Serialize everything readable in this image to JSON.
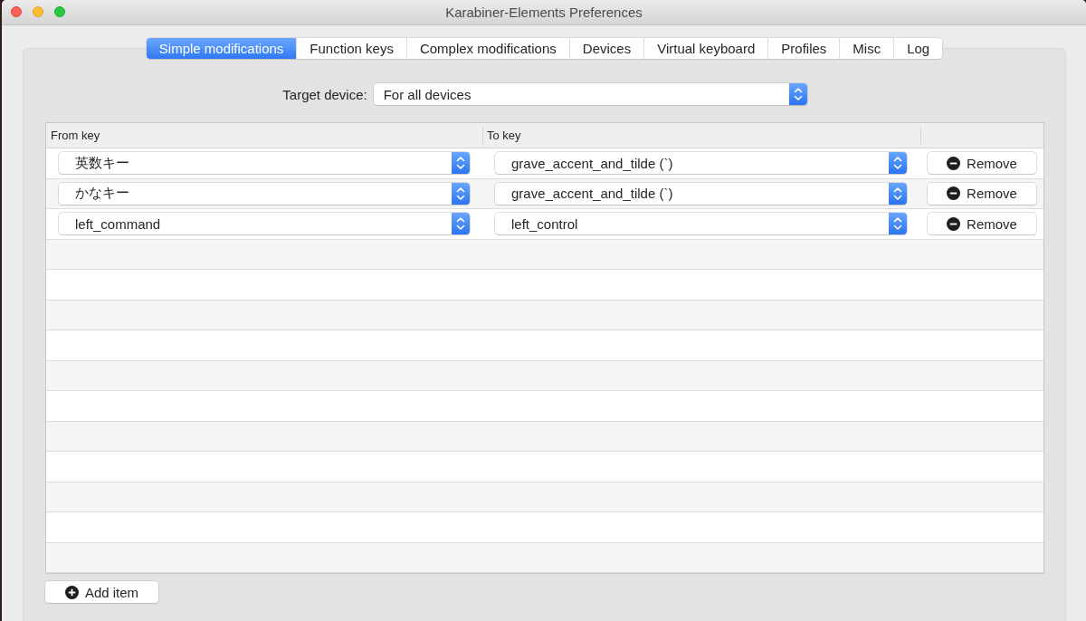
{
  "window": {
    "title": "Karabiner-Elements Preferences"
  },
  "tabs": [
    {
      "label": "Simple modifications",
      "selected": true
    },
    {
      "label": "Function keys",
      "selected": false
    },
    {
      "label": "Complex modifications",
      "selected": false
    },
    {
      "label": "Devices",
      "selected": false
    },
    {
      "label": "Virtual keyboard",
      "selected": false
    },
    {
      "label": "Profiles",
      "selected": false
    },
    {
      "label": "Misc",
      "selected": false
    },
    {
      "label": "Log",
      "selected": false
    }
  ],
  "target_device": {
    "label": "Target device:",
    "value": "For all devices"
  },
  "table": {
    "columns": [
      "From key",
      "To key"
    ],
    "rows": [
      {
        "from_key": "英数キー",
        "to_key": "grave_accent_and_tilde (`)",
        "button": "Remove"
      },
      {
        "from_key": "かなキー",
        "to_key": "grave_accent_and_tilde (`)",
        "button": "Remove"
      },
      {
        "from_key": "left_command",
        "to_key": "left_control",
        "button": "Remove"
      }
    ]
  },
  "add_item_button": {
    "label": "Add item"
  }
}
